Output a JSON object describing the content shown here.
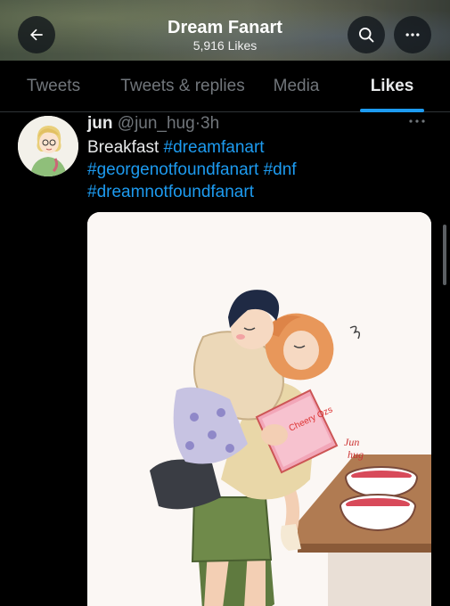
{
  "header": {
    "title": "Dream Fanart",
    "likes_count": "5,916 Likes"
  },
  "tabs": [
    {
      "label": "Tweets"
    },
    {
      "label": "Tweets & replies"
    },
    {
      "label": "Media"
    },
    {
      "label": "Likes"
    }
  ],
  "tweet": {
    "name": "jun",
    "handle": "@jun_hug",
    "separator": "·",
    "time": "3h",
    "text": "Breakfast",
    "hashtags": [
      "#dreamfanart",
      "#georgenotfoundfanart",
      "#dnf",
      "#dreamnotfoundfanart"
    ],
    "media_signature": "Jun hug",
    "media_sign_line1": "Jun",
    "media_sign_line2": "hug",
    "media_box_text": "Cheery Ozs"
  },
  "icons": {
    "back": "arrow-left-icon",
    "search": "search-icon",
    "more": "more-horizontal-icon"
  },
  "colors": {
    "accent": "#1d9bf0",
    "background": "#000000",
    "muted_text": "#71767b"
  }
}
